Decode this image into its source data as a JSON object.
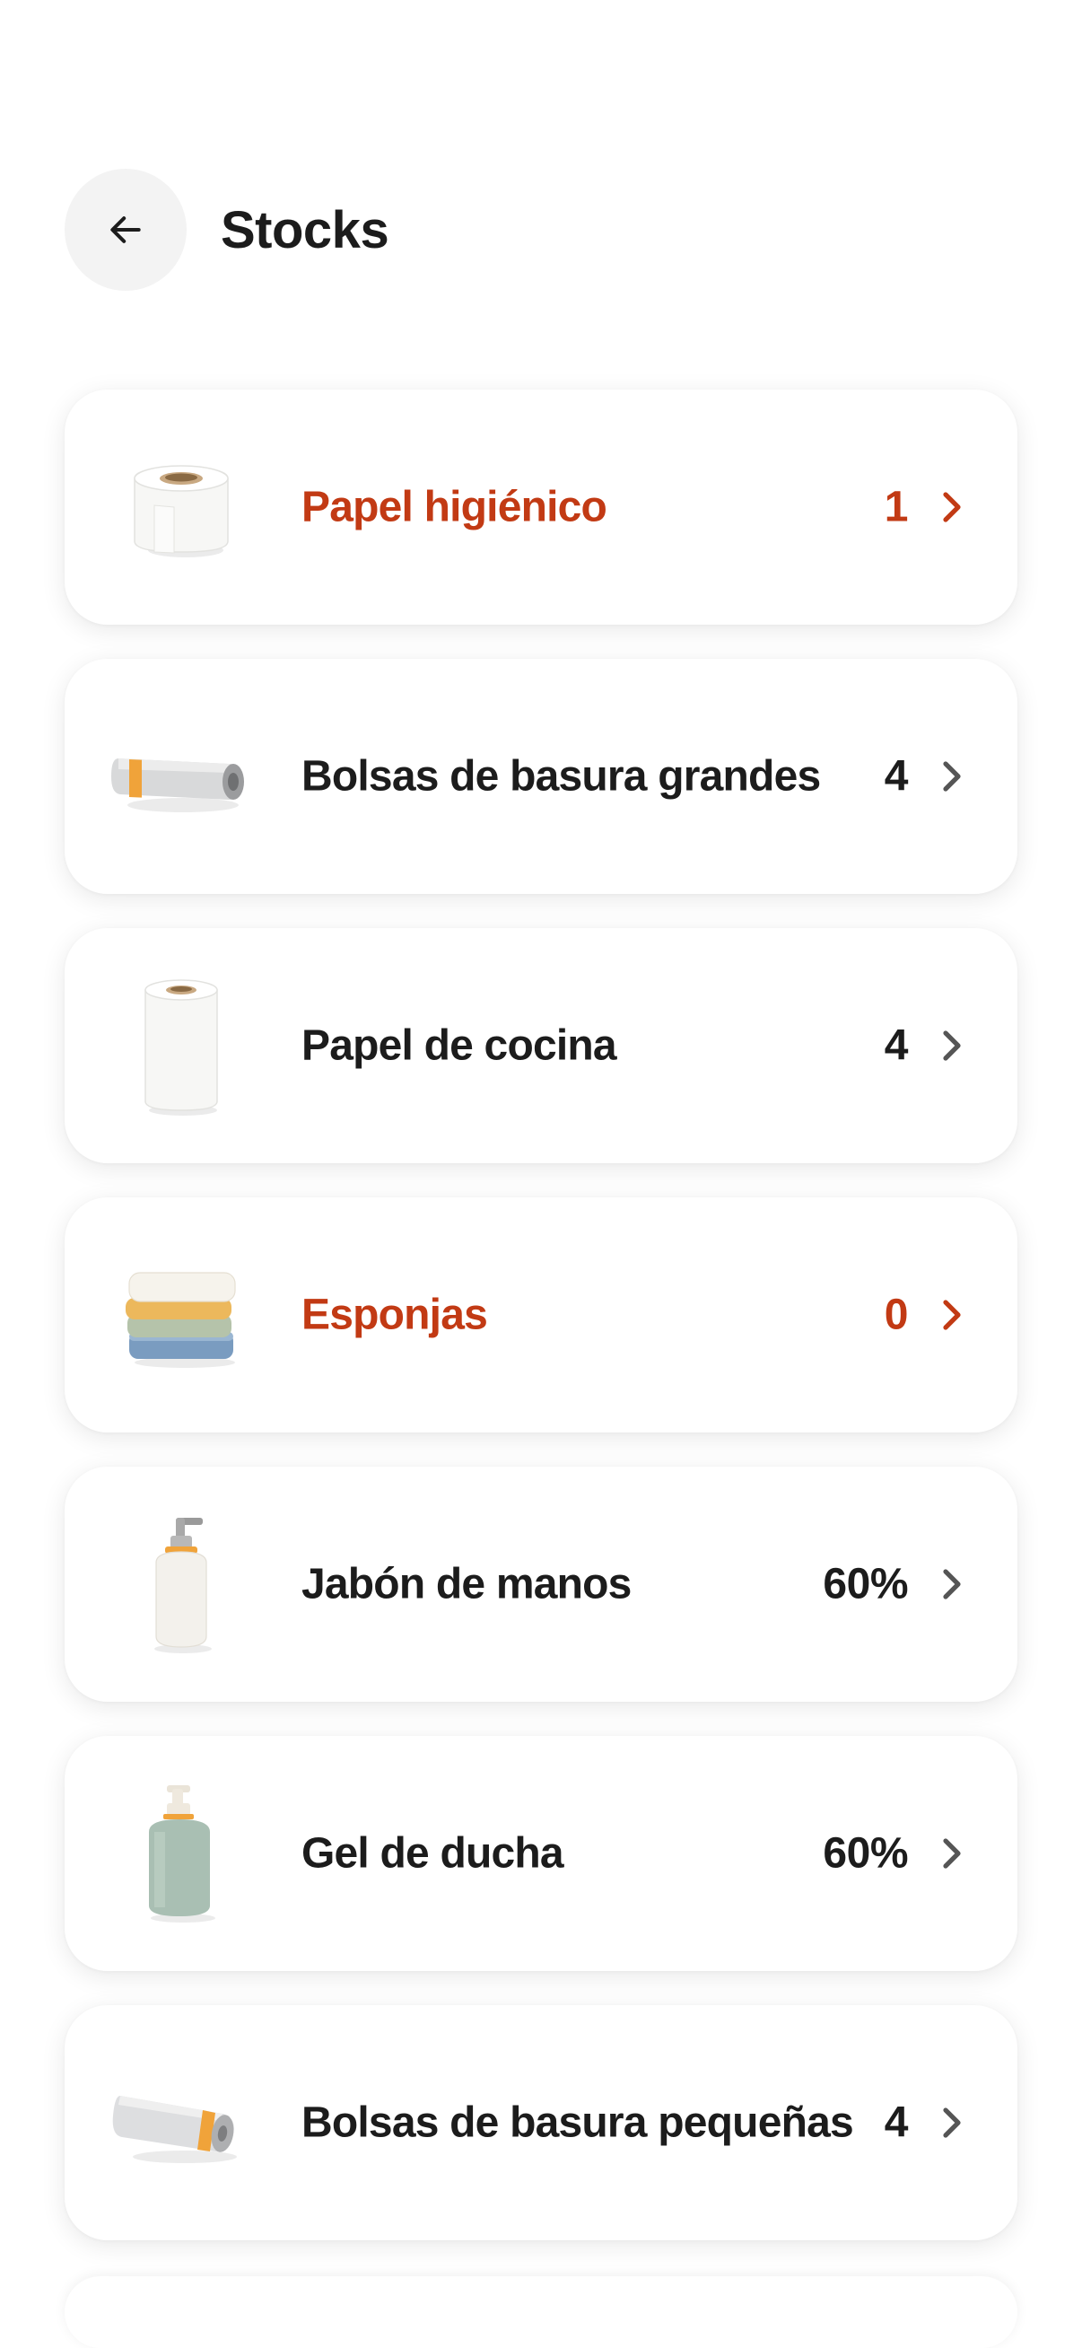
{
  "header": {
    "title": "Stocks",
    "back_icon": "arrow-left-icon"
  },
  "colors": {
    "alert": "#c23a14",
    "text": "#1c1c1c",
    "back_bg": "#f3f3f3"
  },
  "items": [
    {
      "name": "Papel higiénico",
      "quantity": "1",
      "status": "alert",
      "icon": "toilet-paper-icon"
    },
    {
      "name": "Bolsas de basura grandes",
      "quantity": "4",
      "status": "normal",
      "icon": "trash-bag-roll-icon"
    },
    {
      "name": "Papel de cocina",
      "quantity": "4",
      "status": "normal",
      "icon": "kitchen-paper-icon"
    },
    {
      "name": "Esponjas",
      "quantity": "0",
      "status": "alert",
      "icon": "sponges-icon"
    },
    {
      "name": "Jabón de manos",
      "quantity": "60%",
      "status": "normal",
      "icon": "hand-soap-icon"
    },
    {
      "name": "Gel de ducha",
      "quantity": "60%",
      "status": "normal",
      "icon": "shower-gel-icon"
    },
    {
      "name": "Bolsas de basura pequeñas",
      "quantity": "4",
      "status": "normal",
      "icon": "small-trash-bag-roll-icon"
    }
  ]
}
